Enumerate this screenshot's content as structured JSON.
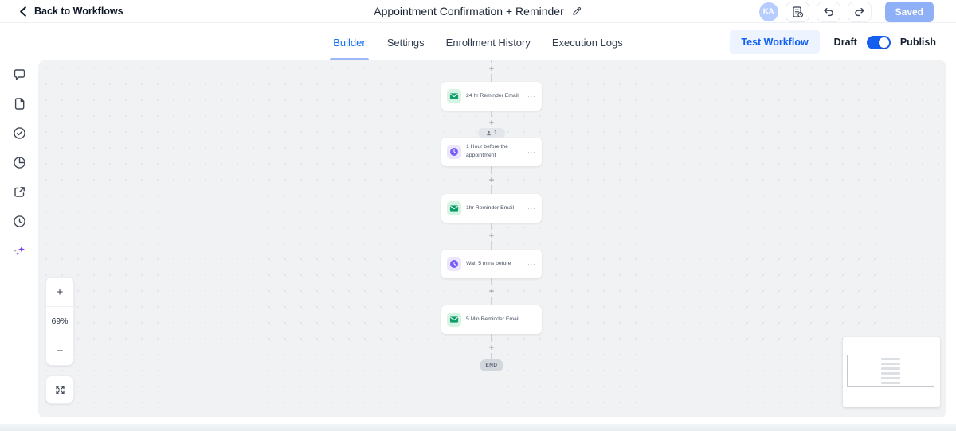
{
  "header": {
    "back_label": "Back to Workflows",
    "title": "Appointment Confirmation + Reminder",
    "avatar_initials": "KA",
    "save_status": "Saved"
  },
  "tabs": [
    {
      "label": "Builder",
      "active": true
    },
    {
      "label": "Settings",
      "active": false
    },
    {
      "label": "Enrollment History",
      "active": false
    },
    {
      "label": "Execution Logs",
      "active": false
    }
  ],
  "actions": {
    "test_workflow": "Test Workflow",
    "draft_label": "Draft",
    "publish_label": "Publish",
    "publish_enabled": true
  },
  "sidebar": {
    "items": [
      {
        "icon": "comments-icon"
      },
      {
        "icon": "document-icon"
      },
      {
        "icon": "check-circle-icon"
      },
      {
        "icon": "stats-pie-icon"
      },
      {
        "icon": "external-link-icon"
      },
      {
        "icon": "history-icon"
      },
      {
        "icon": "ai-sparkles-icon"
      }
    ]
  },
  "canvas": {
    "zoom_level": "69%",
    "zoom_in_glyph": "+",
    "zoom_out_glyph": "−",
    "plus_glyph": "+",
    "menu_glyph": "···",
    "end_label": "END",
    "nodes": [
      {
        "title": "24 hr Reminder Email",
        "icon": "email-icon"
      },
      {
        "title": "1 Hour before the appointment",
        "icon": "wait-icon",
        "badge_count": "1"
      },
      {
        "title": "1hr Reminder Email",
        "icon": "email-icon"
      },
      {
        "title": "Wait 5 mins before",
        "icon": "wait-icon"
      },
      {
        "title": "5 Min Reminder Email",
        "icon": "email-icon"
      }
    ]
  },
  "minimap": {
    "node_bars": 6
  },
  "colors": {
    "accent_blue": "#155eef",
    "active_tab_blue": "#1570ef",
    "saved_button_blue": "#8fb0f6",
    "avatar_blue": "#b7cdff",
    "email_icon_green": "#0f9d6c",
    "email_tile_bg": "#d5f4e4",
    "wait_icon_purple": "#7a5af8",
    "wait_tile_bg": "#ebe6fd",
    "ai_purple": "#7c3aed",
    "canvas_bg": "#f1f2f4",
    "end_pill_bg": "#d2d6dd"
  }
}
